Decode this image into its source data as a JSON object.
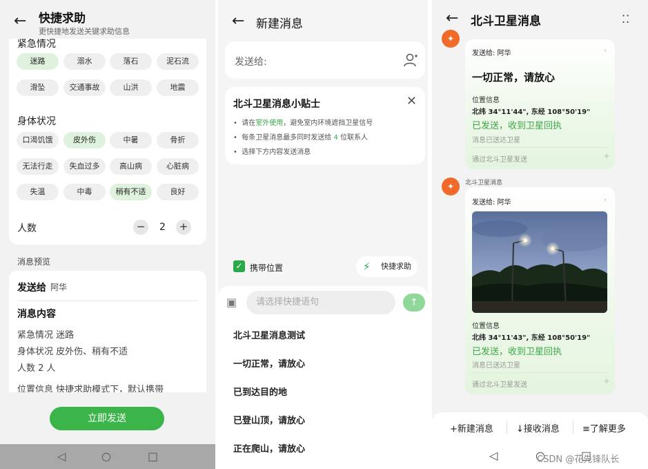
{
  "screen1": {
    "title": "快捷求助",
    "subtitle": "更快捷地发送关键求助信息",
    "emergency": {
      "title": "紧急情况",
      "chips": [
        "迷路",
        "溺水",
        "落石",
        "泥石流",
        "滑坠",
        "交通事故",
        "山洪",
        "地震"
      ]
    },
    "body_status": {
      "title": "身体状况",
      "chips": [
        "口渴饥饿",
        "皮外伤",
        "中暑",
        "骨折",
        "无法行走",
        "失血过多",
        "高山病",
        "心脏病",
        "失温",
        "中毒",
        "稍有不适",
        "良好"
      ]
    },
    "count": {
      "label": "人数",
      "minus": "−",
      "value": "2",
      "plus": "+"
    },
    "preview": {
      "section_label": "消息预览",
      "send_to_label": "发送给",
      "send_to_value": "阿华",
      "content_label": "消息内容",
      "line1": "紧急情况  迷路",
      "line2": "身体状况  皮外伤、稍有不适",
      "line3": "人数  2 人",
      "line4": "位置信息  快捷求助模式下，默认携带"
    },
    "send_button": "立即发送"
  },
  "screen2": {
    "title": "新建消息",
    "recipient_label": "发送给:",
    "tips": {
      "title": "北斗卫星消息小贴士",
      "tip1_a": "请在",
      "tip1_hl": "室外使用",
      "tip1_b": "，避免室内环境遮挡卫星信号",
      "tip2_a": "每条卫星消息最多同时发送给 ",
      "tip2_hl": "4",
      "tip2_b": " 位联系人",
      "tip3": "选择下方内容发送消息"
    },
    "carry_location": "携带位置",
    "quick_help": "快捷求助",
    "input_placeholder": "请选择快捷语句",
    "phrases": [
      "北斗卫星消息测试",
      "一切正常，请放心",
      "已到达目的地",
      "已登山顶，请放心",
      "正在爬山，请放心"
    ]
  },
  "screen3": {
    "title": "北斗卫星消息",
    "msg1": {
      "to": "发送给:  阿华",
      "text": "一切正常，请放心",
      "loc_label": "位置信息",
      "coords": "北纬 34°11'44\", 东经 108°50'19\"",
      "status": "已发送，收到卫星回执",
      "status_sub": "消息已送达卫星",
      "via": "通过北斗卫星发送"
    },
    "sender_name": "北斗卫星消息",
    "msg2": {
      "to": "发送给:  阿华",
      "loc_label": "位置信息",
      "coords": "北纬 34°11'43\", 东经 108°50'19\"",
      "status": "已发送，收到卫星回执",
      "status_sub": "消息已送达卫星",
      "via": "通过北斗卫星发送"
    },
    "actions": [
      "+新建消息",
      "↓接收消息",
      "≡了解更多"
    ]
  },
  "watermark": "CSDN @花先锋队长",
  "colors": {
    "green": "#3bb54a",
    "chip_selected": "#dff2de",
    "avatar": "#f06a2a"
  }
}
